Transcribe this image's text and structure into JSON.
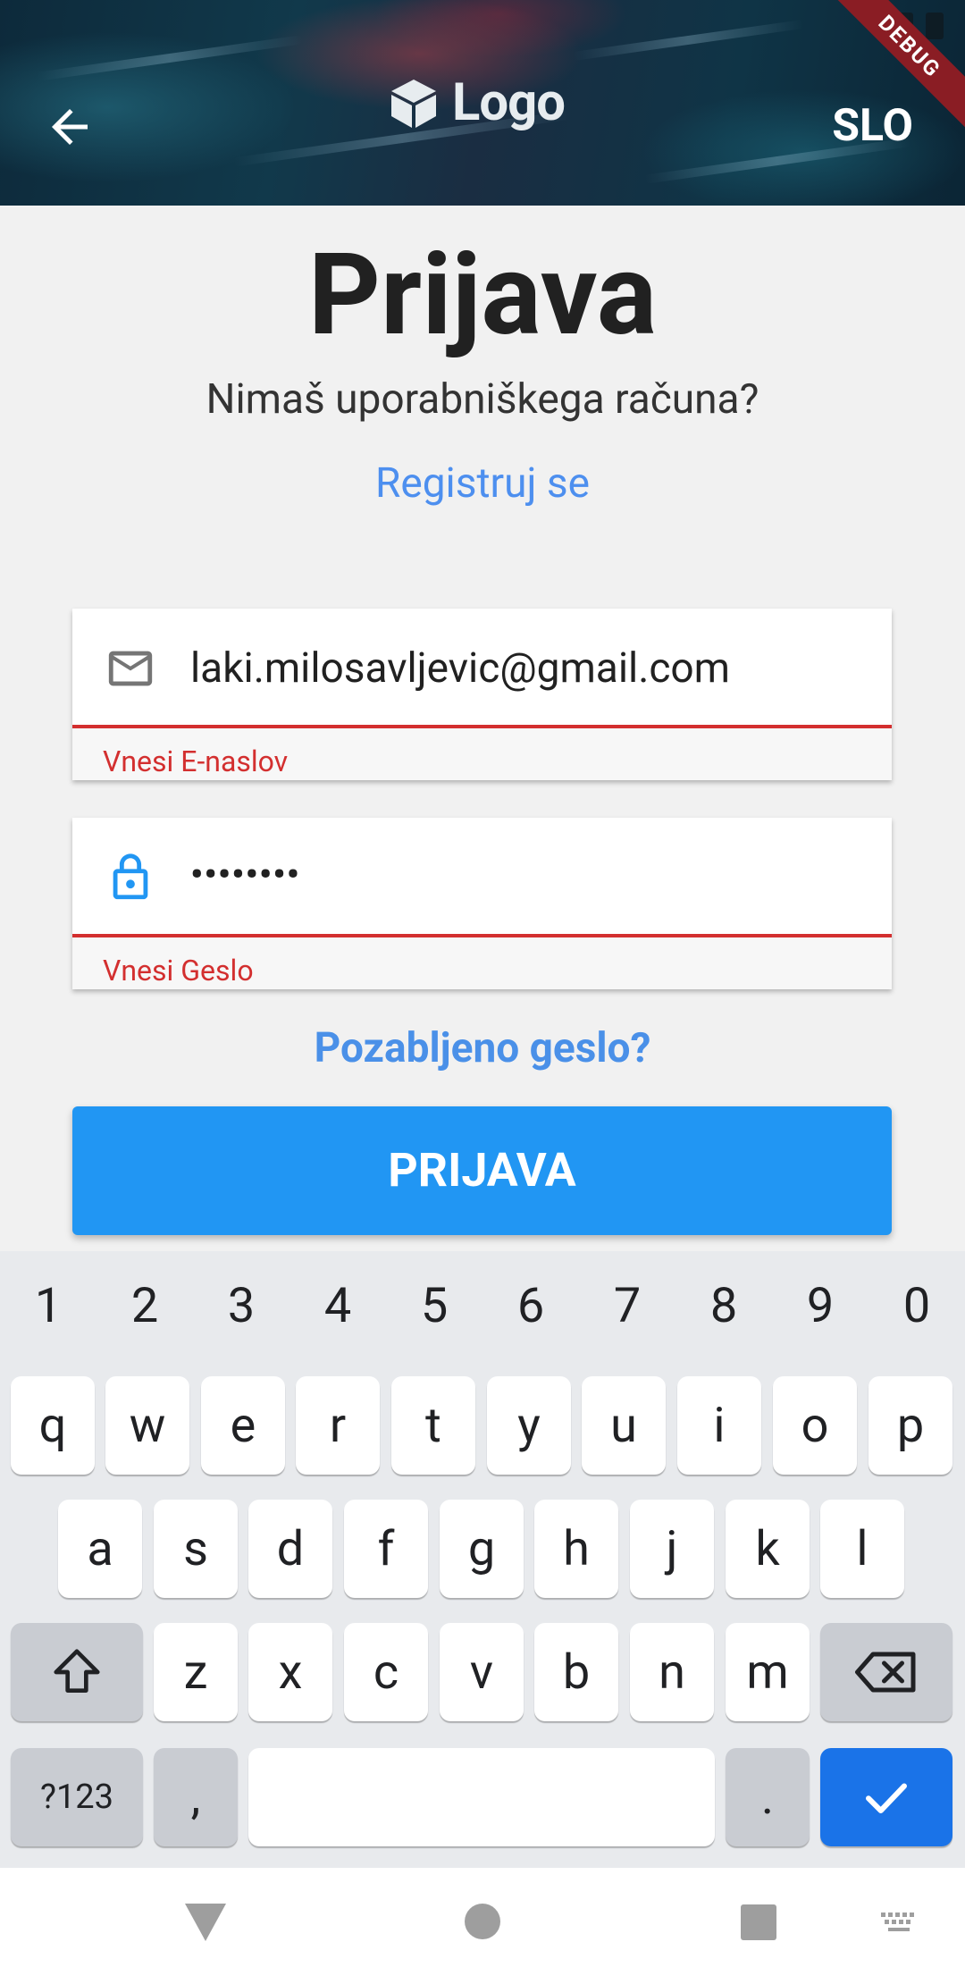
{
  "header": {
    "logo_text": "Logo",
    "language": "SLO",
    "debug_banner": "DEBUG",
    "icons": [
      "back-arrow-icon",
      "logo-cube-icon"
    ]
  },
  "title": "Prijava",
  "subtitle": "Nimaš uporabniškega računa?",
  "register_link": "Registruj se",
  "email_field": {
    "value": "laki.milosavljevic@gmail.com",
    "error": "Vnesi E-naslov",
    "icon": "mail-icon"
  },
  "password_field": {
    "value": "••••••••",
    "error": "Vnesi Geslo",
    "icon": "lock-icon"
  },
  "forgot_link": "Pozabljeno geslo?",
  "login_button": "PRIJAVA",
  "keyboard": {
    "numbers": [
      "1",
      "2",
      "3",
      "4",
      "5",
      "6",
      "7",
      "8",
      "9",
      "0"
    ],
    "row1": [
      "q",
      "w",
      "e",
      "r",
      "t",
      "y",
      "u",
      "i",
      "o",
      "p"
    ],
    "row2": [
      "a",
      "s",
      "d",
      "f",
      "g",
      "h",
      "j",
      "k",
      "l"
    ],
    "row3": [
      "z",
      "x",
      "c",
      "v",
      "b",
      "n",
      "m"
    ],
    "symbols_key": "?123",
    "comma_key": ",",
    "period_key": "."
  },
  "colors": {
    "accent": "#2196f3",
    "link": "#4d8fef",
    "error": "#d32f2f",
    "keyboard_enter": "#1a73e8"
  }
}
